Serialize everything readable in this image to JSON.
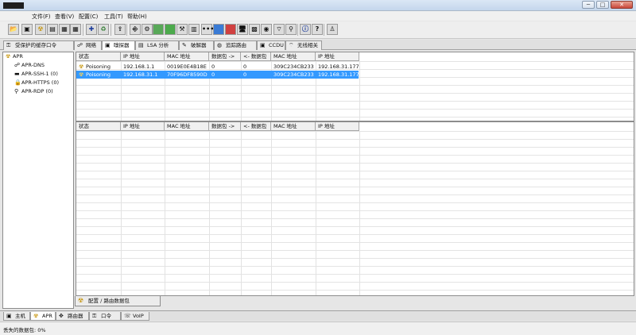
{
  "window": {
    "title": "",
    "controls": {
      "minimize": "─",
      "maximize": "□",
      "close": "✕"
    }
  },
  "menu": [
    "文件(F)",
    "查看(V)",
    "配置(C)",
    "工具(T)",
    "帮助(H)"
  ],
  "tabs": [
    {
      "label": "受保护的缓存口令",
      "icon": "key-icon"
    },
    {
      "label": "网络",
      "icon": "network-icon"
    },
    {
      "label": "嗅探器",
      "icon": "sniffer-icon"
    },
    {
      "label": "LSA 分析",
      "icon": "lsa-icon"
    },
    {
      "label": "破解器",
      "icon": "cracker-icon"
    },
    {
      "label": "追踪路由",
      "icon": "traceroute-icon"
    },
    {
      "label": "CCDU",
      "icon": "ccdu-icon"
    },
    {
      "label": "无线相关",
      "icon": "wireless-icon"
    }
  ],
  "tree": {
    "root": "APR",
    "children": [
      "APR-DNS",
      "APR-SSH-1 (0)",
      "APR-HTTPS (0)",
      "APR-RDP (0)"
    ]
  },
  "top_grid": {
    "columns": [
      "状态",
      "IP 地址",
      "MAC 地址",
      "数据包 ->",
      "<- 数据包",
      "MAC 地址",
      "IP 地址"
    ],
    "rows": [
      {
        "status": "Poisoning",
        "ip1": "192.168.1.1",
        "mac1": "0019E0E4B18E",
        "pkt_out": "0",
        "pkt_in": "0",
        "mac2": "309C234CB233",
        "ip2": "192.168.31.177",
        "selected": false
      },
      {
        "status": "Poisoning",
        "ip1": "192.168.31.1",
        "mac1": "70F96DF8590D",
        "pkt_out": "0",
        "pkt_in": "0",
        "mac2": "309C234CB233",
        "ip2": "192.168.31.177",
        "selected": true
      }
    ]
  },
  "bottom_grid": {
    "columns": [
      "状态",
      "IP 地址",
      "MAC 地址",
      "数据包 ->",
      "<- 数据包",
      "MAC 地址",
      "IP 地址"
    ]
  },
  "bottom_tab": "配置 / 路由数据包",
  "lower_tabs": [
    "主机",
    "APR",
    "路由器",
    "口令",
    "VoIP"
  ],
  "status": {
    "text": "丢失的数据包:  0%"
  },
  "colors": {
    "selection": "#3399ff",
    "poison_icon": "#d4a000"
  }
}
